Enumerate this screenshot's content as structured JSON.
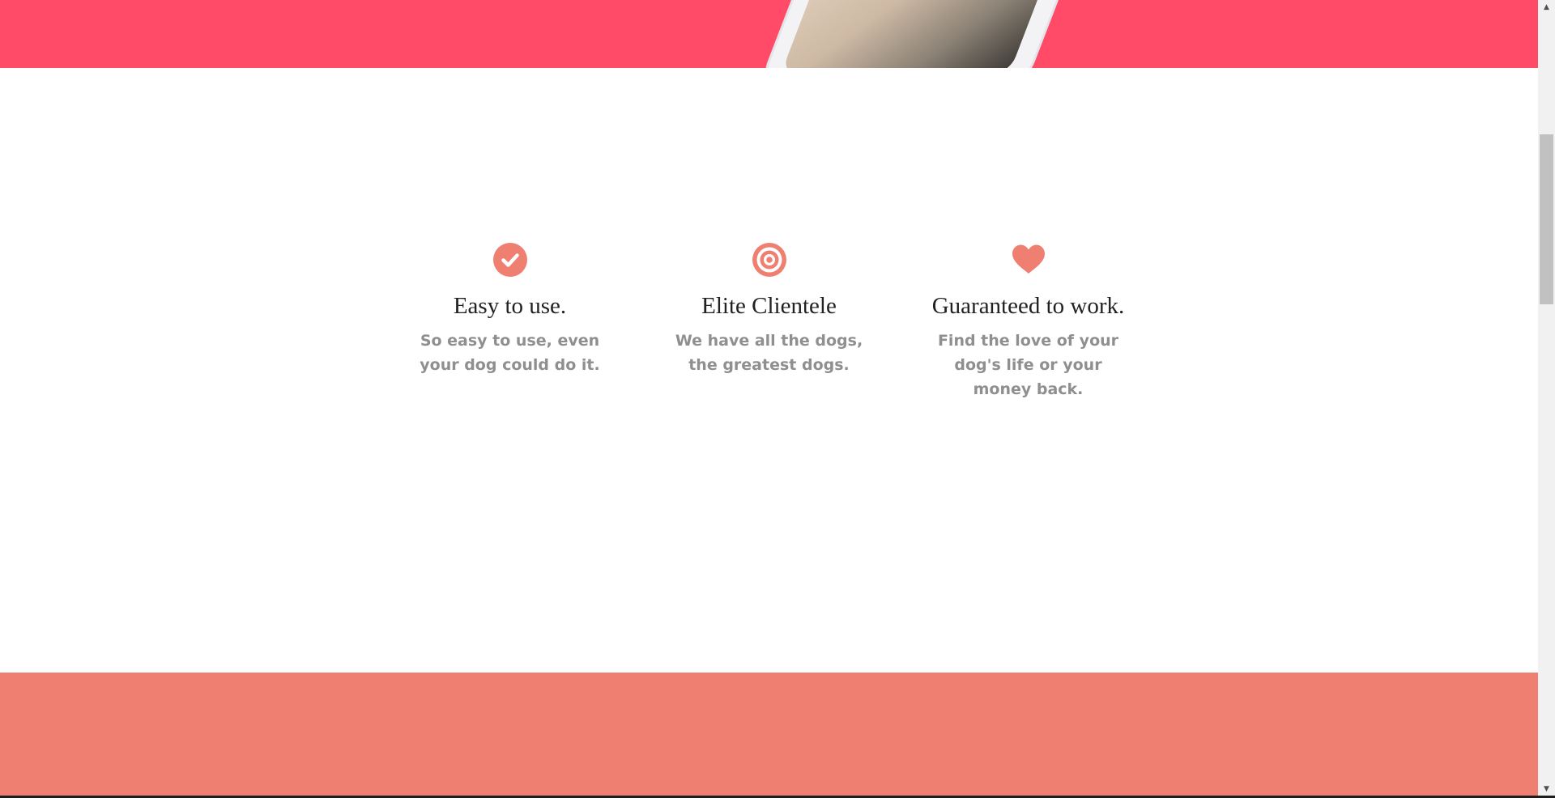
{
  "colors": {
    "hero_band": "#ff4a68",
    "accent": "#ef7f70",
    "title_text": "#212121",
    "desc_text": "#8f8f8f"
  },
  "hero": {
    "image": "phone-with-dog-photo"
  },
  "features": [
    {
      "icon": "check-circle-icon",
      "title": "Easy to use.",
      "description": "So easy to use, even your dog could do it."
    },
    {
      "icon": "bullseye-icon",
      "title": "Elite Clientele",
      "description": "We have all the dogs, the greatest dogs."
    },
    {
      "icon": "heart-icon",
      "title": "Guaranteed to work.",
      "description": "Find the love of your dog's life or your money back."
    }
  ],
  "scrollbar": {
    "up_arrow": "▲",
    "down_arrow": "▼"
  }
}
